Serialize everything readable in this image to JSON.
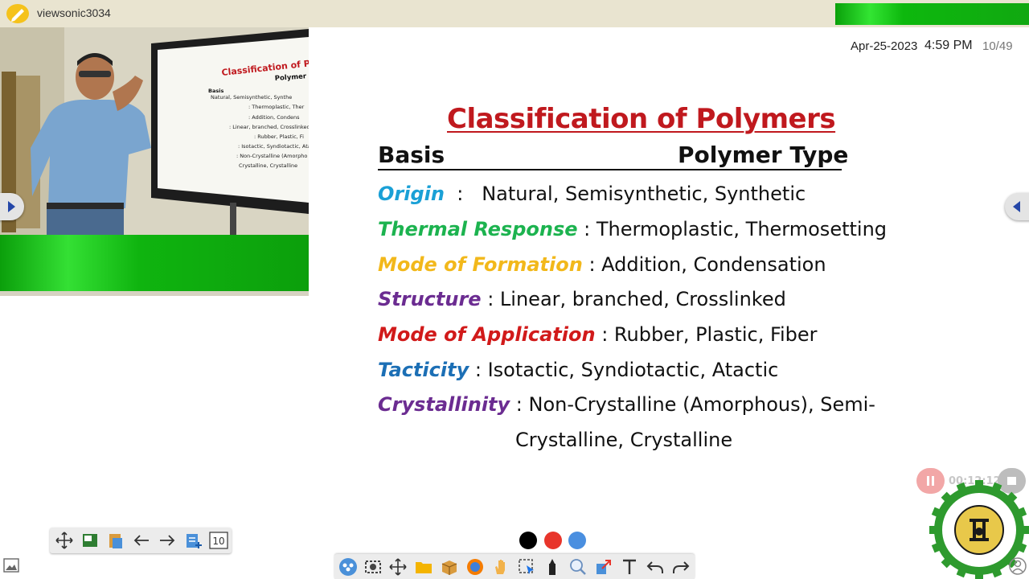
{
  "app": {
    "title": "viewsonic3034"
  },
  "status": {
    "date": "Apr-25-2023",
    "time": "4:59 PM",
    "page": "10/49"
  },
  "slide": {
    "title": "Classification of Polymers",
    "header_left": "Basis",
    "header_right": "Polymer Type",
    "rows": [
      {
        "term": "Origin",
        "sep": "  :   ",
        "value": "Natural, Semisynthetic, Synthetic",
        "color": "#1aa0d6"
      },
      {
        "term": "Thermal Response",
        "sep": " : ",
        "value": "Thermoplastic, Thermosetting",
        "color": "#1cb34f"
      },
      {
        "term": "Mode of Formation",
        "sep": " : ",
        "value": "Addition, Condensation",
        "color": "#f2b81b"
      },
      {
        "term": "Structure",
        "sep": " : ",
        "value": "Linear, branched, Crosslinked",
        "color": "#6b2c91"
      },
      {
        "term": "Mode of Application",
        "sep": " : ",
        "value": "Rubber, Plastic, Fiber",
        "color": "#d11a1a"
      },
      {
        "term": "Tacticity",
        "sep": " : ",
        "value": "Isotactic, Syndiotactic, Atactic",
        "color": "#1c6fb5"
      },
      {
        "term": "Crystallinity",
        "sep": " : ",
        "value": "Non-Crystalline (Amorphous), Semi-",
        "color": "#6b2c91"
      }
    ],
    "continuation": "Crystalline, Crystalline"
  },
  "video_slide": {
    "title": "Classification of Polym",
    "type_label": "Polymer",
    "basis_label": "Basis",
    "lines": [
      "Natural, Semisynthetic, Synthe",
      ": Thermoplastic, Ther",
      ": Addition, Condens",
      ": Linear, branched, Crosslinked",
      ": Rubber, Plastic, Fi",
      ": Isotactic, Syndiotactic, Atactic",
      ": Non-Crystalline (Amorpho",
      "Crystalline, Crystalline"
    ]
  },
  "recording": {
    "timer": "00:12:12"
  },
  "pen_colors": [
    "#000000",
    "#e8352b",
    "#4a8fe0"
  ],
  "toolbar_left": {
    "page_icon_label": "10"
  },
  "logo": {
    "ring_text": "HALDIA INSTITUTE OF TECHNOLOGY",
    "bottom_text": "JNANAM VIJNANAM SAHITAM"
  },
  "toolbar_icons": [
    "people-icon",
    "screenshot-icon",
    "move-icon",
    "folder-icon",
    "box-icon",
    "browser-icon",
    "hand-icon",
    "select-icon",
    "marker-icon",
    "search-icon",
    "share-icon",
    "text-icon",
    "undo-icon",
    "redo-icon"
  ]
}
